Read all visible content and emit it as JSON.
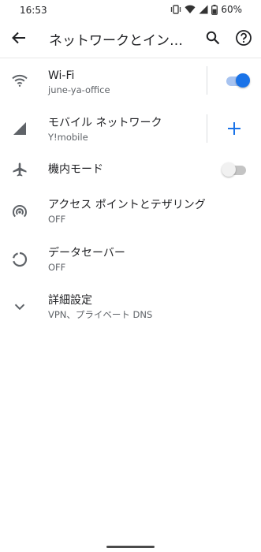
{
  "status_bar": {
    "time": "16:53",
    "battery": "60%"
  },
  "app_bar": {
    "title": "ネットワークとインターネット"
  },
  "items": [
    {
      "label": "Wi-Fi",
      "sub": "june-ya-office",
      "icon": "wifi-icon",
      "toggle": true
    },
    {
      "label": "モバイル ネットワーク",
      "sub": "Y!mobile",
      "icon": "signal-icon"
    },
    {
      "label": "機内モード",
      "icon": "airplane-icon",
      "toggle": false
    },
    {
      "label": "アクセス ポイントとテザリング",
      "sub": "OFF",
      "icon": "hotspot-icon"
    },
    {
      "label": "データセーバー",
      "sub": "OFF",
      "icon": "data-saver-icon"
    },
    {
      "label": "詳細設定",
      "sub": "VPN、プライベート DNS",
      "icon": "chevron-down-icon"
    }
  ],
  "colors": {
    "accent": "#1a73e8",
    "icon": "#5f6368",
    "text_primary": "#202124",
    "text_secondary": "#5f6368"
  }
}
